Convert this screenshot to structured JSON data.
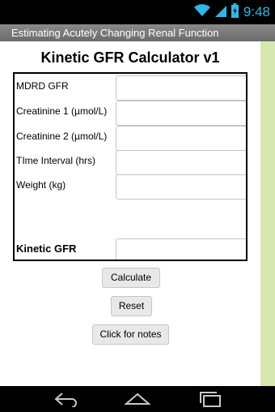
{
  "status_bar": {
    "time": "9:48",
    "icons": [
      "wifi-icon",
      "signal-icon",
      "battery-icon"
    ]
  },
  "title_bar": {
    "title": "Estimating Acutely Changing Renal Function"
  },
  "app": {
    "heading": "Kinetic GFR Calculator v1",
    "fields": [
      {
        "label": "MDRD GFR",
        "value": ""
      },
      {
        "label": "Creatinine 1 (µmol/L)",
        "value": ""
      },
      {
        "label": "Creatinine 2 (µmol/L)",
        "value": ""
      },
      {
        "label": "TIme Interval (hrs)",
        "value": ""
      },
      {
        "label": "Weight (kg)",
        "value": ""
      }
    ],
    "result": {
      "label": "Kinetic GFR",
      "value": ""
    },
    "buttons": {
      "calculate": "Calculate",
      "reset": "Reset",
      "notes": "Click for notes"
    }
  },
  "nav_bar": {
    "icons": [
      "back-icon",
      "home-icon",
      "recent-apps-icon"
    ]
  },
  "colors": {
    "accent": "#33b5e5",
    "side_strip": "#d6e8b0",
    "title_bar": "#7a7a7a"
  }
}
